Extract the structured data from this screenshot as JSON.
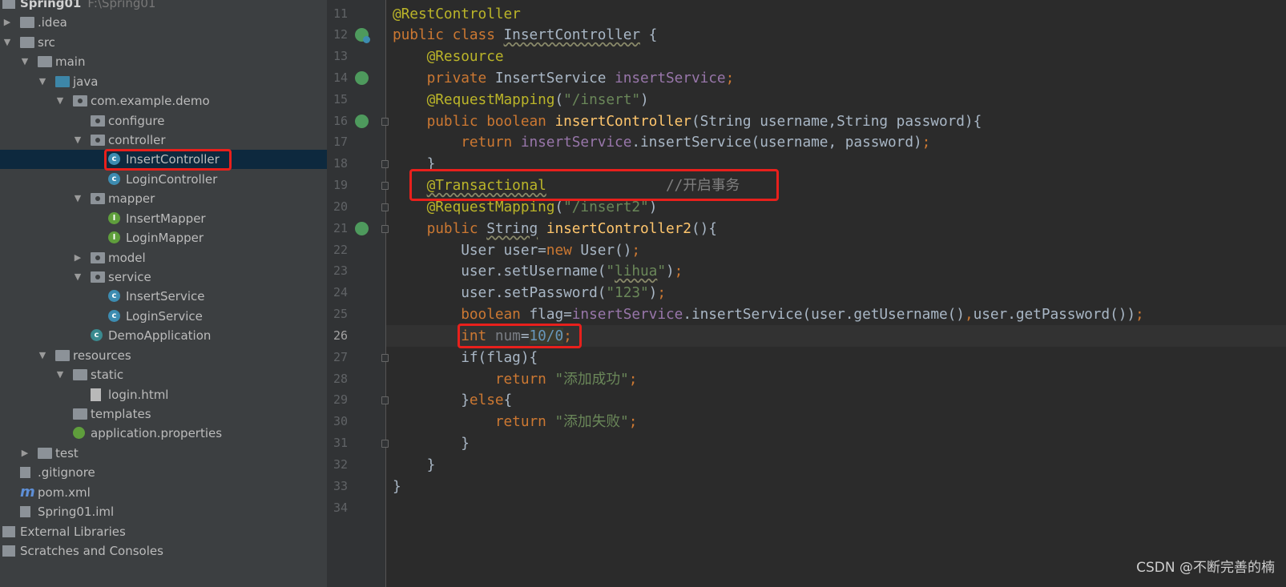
{
  "project_tree": {
    "items": [
      {
        "label": "Spring01",
        "hint": "F:\\Spring01",
        "level": -1,
        "icon": "project-icon",
        "expanded": null
      },
      {
        "label": ".idea",
        "level": 0,
        "icon": "folder-icon",
        "expanded": false
      },
      {
        "label": "src",
        "level": 0,
        "icon": "folder-icon",
        "expanded": true
      },
      {
        "label": "main",
        "level": 1,
        "icon": "folder-icon",
        "expanded": true
      },
      {
        "label": "java",
        "level": 2,
        "icon": "source-folder-icon",
        "expanded": true
      },
      {
        "label": "com.example.demo",
        "level": 3,
        "icon": "package-icon",
        "expanded": true
      },
      {
        "label": "configure",
        "level": 4,
        "icon": "package-icon",
        "expanded": null
      },
      {
        "label": "controller",
        "level": 4,
        "icon": "package-icon",
        "expanded": true
      },
      {
        "label": "InsertController",
        "level": 5,
        "icon": "class-icon",
        "selected": true
      },
      {
        "label": "LoginController",
        "level": 5,
        "icon": "class-icon"
      },
      {
        "label": "mapper",
        "level": 4,
        "icon": "package-icon",
        "expanded": true
      },
      {
        "label": "InsertMapper",
        "level": 5,
        "icon": "interface-icon"
      },
      {
        "label": "LoginMapper",
        "level": 5,
        "icon": "interface-icon"
      },
      {
        "label": "model",
        "level": 4,
        "icon": "package-icon",
        "expanded": false
      },
      {
        "label": "service",
        "level": 4,
        "icon": "package-icon",
        "expanded": true
      },
      {
        "label": "InsertService",
        "level": 5,
        "icon": "class-icon"
      },
      {
        "label": "LoginService",
        "level": 5,
        "icon": "class-icon"
      },
      {
        "label": "DemoApplication",
        "level": 4,
        "icon": "spring-boot-class-icon"
      },
      {
        "label": "resources",
        "level": 2,
        "icon": "resources-folder-icon",
        "expanded": true
      },
      {
        "label": "static",
        "level": 3,
        "icon": "folder-icon",
        "expanded": true
      },
      {
        "label": "login.html",
        "level": 4,
        "icon": "html-file-icon"
      },
      {
        "label": "templates",
        "level": 3,
        "icon": "folder-icon",
        "expanded": null
      },
      {
        "label": "application.properties",
        "level": 3,
        "icon": "properties-file-icon"
      },
      {
        "label": "test",
        "level": 1,
        "icon": "folder-icon",
        "expanded": false
      },
      {
        "label": ".gitignore",
        "level": 0,
        "icon": "gitignore-file-icon"
      },
      {
        "label": "pom.xml",
        "level": 0,
        "icon": "maven-icon"
      },
      {
        "label": "Spring01.iml",
        "level": 0,
        "icon": "iml-file-icon"
      },
      {
        "label": "External Libraries",
        "level": -1,
        "icon": "libraries-icon",
        "expanded": null
      },
      {
        "label": "Scratches and Consoles",
        "level": -1,
        "icon": "scratches-icon",
        "expanded": null
      }
    ]
  },
  "editor": {
    "current_line": 26,
    "lines": [
      {
        "n": 11,
        "tokens": [
          [
            "@RestController",
            "ann"
          ]
        ]
      },
      {
        "n": 12,
        "gutter": "bean-class-icon",
        "tokens": [
          [
            "public class ",
            "kw"
          ],
          [
            "InsertController",
            "wavy"
          ],
          [
            " {",
            ""
          ]
        ]
      },
      {
        "n": 13,
        "tokens": [
          [
            "    ",
            ""
          ],
          [
            "@Resource",
            "ann"
          ]
        ]
      },
      {
        "n": 14,
        "gutter": "autowired-icon",
        "tokens": [
          [
            "    ",
            ""
          ],
          [
            "private ",
            "kw"
          ],
          [
            "InsertService ",
            ""
          ],
          [
            "insertService",
            "fld"
          ],
          [
            ";",
            "kw"
          ]
        ]
      },
      {
        "n": 15,
        "tokens": [
          [
            "    ",
            ""
          ],
          [
            "@RequestMapping",
            "ann"
          ],
          [
            "(",
            ""
          ],
          [
            "\"/insert\"",
            "str"
          ],
          [
            ")",
            ""
          ]
        ]
      },
      {
        "n": 16,
        "gutter": "web-endpoint-icon",
        "fold": true,
        "tokens": [
          [
            "    ",
            ""
          ],
          [
            "public boolean ",
            "kw"
          ],
          [
            "insertController",
            "fn"
          ],
          [
            "(String username,String password){",
            ""
          ]
        ]
      },
      {
        "n": 17,
        "tokens": [
          [
            "        ",
            ""
          ],
          [
            "return ",
            "kw"
          ],
          [
            "insertService",
            "fld"
          ],
          [
            ".insertService(username, password)",
            ""
          ],
          [
            ";",
            "kw"
          ]
        ]
      },
      {
        "n": 18,
        "fold": true,
        "tokens": [
          [
            "    }",
            ""
          ]
        ]
      },
      {
        "n": 19,
        "fold": true,
        "tokens": [
          [
            "    ",
            ""
          ],
          [
            "@Transactional",
            "ann wavy"
          ],
          [
            "              //开启事务",
            "cm"
          ]
        ]
      },
      {
        "n": 20,
        "fold": true,
        "tokens": [
          [
            "    ",
            ""
          ],
          [
            "@RequestMapping",
            "ann"
          ],
          [
            "(",
            ""
          ],
          [
            "\"/insert2\"",
            "str"
          ],
          [
            ")",
            ""
          ]
        ]
      },
      {
        "n": 21,
        "gutter": "web-endpoint-icon",
        "fold": true,
        "tokens": [
          [
            "    ",
            ""
          ],
          [
            "public ",
            "kw"
          ],
          [
            "String",
            "wavy"
          ],
          [
            " ",
            ""
          ],
          [
            "insertController2",
            "fn"
          ],
          [
            "(){",
            ""
          ]
        ]
      },
      {
        "n": 22,
        "tokens": [
          [
            "        User user=",
            ""
          ],
          [
            "new ",
            "kw"
          ],
          [
            "User()",
            ""
          ],
          [
            ";",
            "kw"
          ]
        ]
      },
      {
        "n": 23,
        "tokens": [
          [
            "        user.setUsername(",
            ""
          ],
          [
            "\"",
            "str"
          ],
          [
            "lihua",
            "str wavy"
          ],
          [
            "\"",
            "str"
          ],
          [
            ")",
            ""
          ],
          [
            ";",
            "kw"
          ]
        ]
      },
      {
        "n": 24,
        "tokens": [
          [
            "        user.setPassword(",
            ""
          ],
          [
            "\"123\"",
            "str"
          ],
          [
            ")",
            ""
          ],
          [
            ";",
            "kw"
          ]
        ]
      },
      {
        "n": 25,
        "tokens": [
          [
            "        ",
            ""
          ],
          [
            "boolean ",
            "kw"
          ],
          [
            "flag=",
            ""
          ],
          [
            "insertService",
            "fld"
          ],
          [
            ".insertService(user.getUsername()",
            ""
          ],
          [
            ",",
            "kw"
          ],
          [
            "user.getPassword())",
            ""
          ],
          [
            ";",
            "kw"
          ]
        ]
      },
      {
        "n": 26,
        "tokens": [
          [
            "        ",
            ""
          ],
          [
            "int ",
            "kw"
          ],
          [
            "num",
            "unused"
          ],
          [
            "=",
            ""
          ],
          [
            "10/0",
            "num hl"
          ],
          [
            ";",
            "kw"
          ]
        ]
      },
      {
        "n": 27,
        "fold": true,
        "tokens": [
          [
            "        if(flag){",
            ""
          ]
        ]
      },
      {
        "n": 28,
        "tokens": [
          [
            "            ",
            ""
          ],
          [
            "return ",
            "kw"
          ],
          [
            "\"添加成功\"",
            "str"
          ],
          [
            ";",
            "kw"
          ]
        ]
      },
      {
        "n": 29,
        "fold": true,
        "tokens": [
          [
            "        }",
            ""
          ],
          [
            "else",
            "kw"
          ],
          [
            "{",
            ""
          ]
        ]
      },
      {
        "n": 30,
        "tokens": [
          [
            "            ",
            ""
          ],
          [
            "return ",
            "kw"
          ],
          [
            "\"添加失败\"",
            "str"
          ],
          [
            ";",
            "kw"
          ]
        ]
      },
      {
        "n": 31,
        "fold": true,
        "tokens": [
          [
            "        }",
            ""
          ]
        ]
      },
      {
        "n": 32,
        "tokens": [
          [
            "    }",
            ""
          ]
        ]
      },
      {
        "n": 33,
        "tokens": [
          [
            "}",
            ""
          ]
        ]
      },
      {
        "n": 34,
        "tokens": []
      }
    ]
  },
  "annotations": {
    "highlight_color": "#e8201c"
  },
  "watermark": "CSDN @不断完善的楠"
}
